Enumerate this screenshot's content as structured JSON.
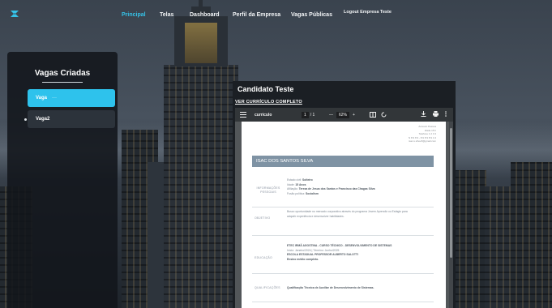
{
  "nav": {
    "items": [
      "Principal",
      "Telas",
      "Dashboard",
      "Perfil da Empresa",
      "Vagas Públicas"
    ],
    "active_index": 0,
    "user": "Logout Empresa Teste",
    "accent_color": "#36c3e8"
  },
  "sidebar": {
    "title": "Vagas Criadas",
    "items": [
      {
        "label": "Vaga",
        "suffix": "···",
        "active": true
      },
      {
        "label": "Vaga2",
        "active": false
      }
    ]
  },
  "candidate": {
    "name": "Candidato Teste",
    "cv_link": "VER CURRÍCULO COMPLETO"
  },
  "pdf_viewer": {
    "file_name": "curriculo",
    "page_current": "1",
    "page_total": "/ 1",
    "zoom_minus": "—",
    "zoom": "62%",
    "zoom_plus": "+",
    "icons": [
      "menu-icon",
      "fit-page-icon",
      "rotate-icon",
      "download-icon",
      "print-icon",
      "more-icon"
    ]
  },
  "resume": {
    "contact": [
      "Account Pessoa",
      "Idade 15 h",
      "Telefone 1 2 3 4",
      "N 8 9 8 9 - 8 9 8 9 8 9 4 4",
      "isac.s.silva.8@gmail.com"
    ],
    "full_name": "ISAC DOS SANTOS SILVA",
    "info_label": "INFORMAÇÕES PESSOAIS",
    "info_lines": [
      {
        "label": "Estado civil:",
        "value": "Solteiro"
      },
      {
        "label": "Idade:",
        "value": "15 Anos"
      },
      {
        "label": "Afiliação:",
        "value": "Tereza de Jesus dos Santos e Francisco das Chagas Silva"
      },
      {
        "label": "Fusão política:",
        "value": "Socialism"
      }
    ],
    "objective_label": "OBJETIVO",
    "objective_text": "Busco oportunidade no mercado corporativo através do programa Jovem Aprendiz ou Estágio para adquirir experiência e desenvolver habilidades.",
    "education_label": "EDUCAÇÃO",
    "education_lines": [
      {
        "text": "ETEC IRMÃ AGOSTINA - CURSO TÉCNICO - DESENVOLVIMENTO DE SISTEMAS",
        "bold": true
      },
      {
        "text": "Início: Janeiro/2024 | Término: Junho/2025",
        "bold": false
      },
      {
        "text": "ESCOLA ESTADUAL PROFESSOR ALBERTO SALOTTI",
        "bold": true
      },
      {
        "text": "Ensino médio completo.",
        "bold": false
      }
    ],
    "qualifications_label": "QUALIFICAÇÕES",
    "qualifications_text": "Qualificação Técnica de Auxiliar de Desenvolvimento de Sistemas."
  }
}
